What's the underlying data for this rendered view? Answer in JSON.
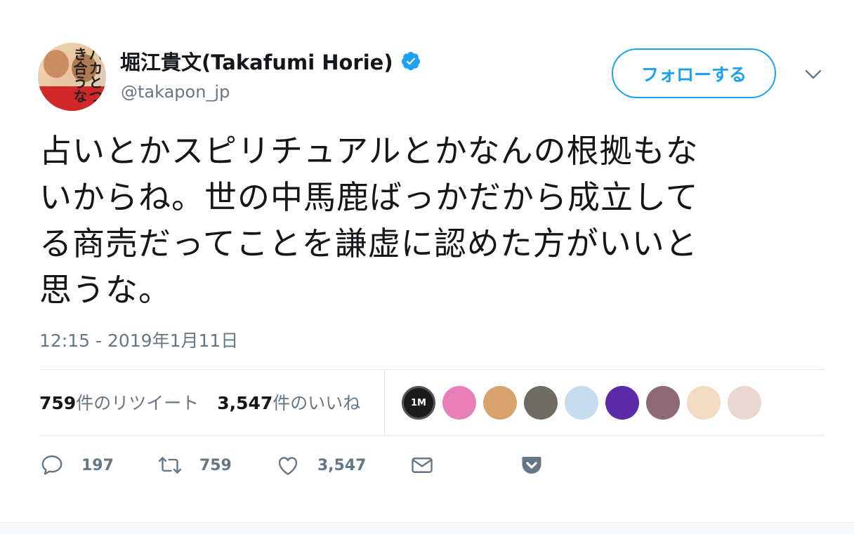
{
  "user": {
    "display_name": "堀江貴文(Takafumi Horie)",
    "handle": "@takapon_jp",
    "avatar_text": "バカとつき合うな",
    "verified": true
  },
  "follow_button": {
    "label": "フォローする"
  },
  "tweet": {
    "lines": [
      "占いとかスピリチュアルとかなんの根拠もな",
      "いからね。世の中馬鹿ばっかだから成立して",
      "る商売だってことを謙虚に認めた方がいいと",
      "思うな。"
    ],
    "timestamp": "12:15 - 2019年1月11日"
  },
  "stats": {
    "retweets_count": "759",
    "retweets_label": "件のリツイート",
    "likes_count": "3,547",
    "likes_label": "件のいいね"
  },
  "likers": [
    {
      "icon": "1m-logo-avatar",
      "text": "1M",
      "color": "#1b1b1b"
    },
    {
      "icon": "pink-character-avatar",
      "color": "#e97fb8"
    },
    {
      "icon": "woman-glasses-avatar",
      "color": "#d9a36c"
    },
    {
      "icon": "room-photo-avatar",
      "color": "#6f6a63"
    },
    {
      "icon": "seal-avatar",
      "color": "#c7dcec"
    },
    {
      "icon": "concert-avatar",
      "color": "#5a2aa8"
    },
    {
      "icon": "woman-photo-avatar",
      "color": "#8c6b75"
    },
    {
      "icon": "bald-man-avatar",
      "color": "#f1dcc3"
    },
    {
      "icon": "illustration-avatar",
      "color": "#ead7cf"
    }
  ],
  "actions": {
    "reply_count": "197",
    "retweet_count": "759",
    "like_count": "3,547"
  },
  "colors": {
    "accent": "#1da1f2",
    "text": "#14171a",
    "secondary": "#657786",
    "border": "#e1e8ed"
  }
}
